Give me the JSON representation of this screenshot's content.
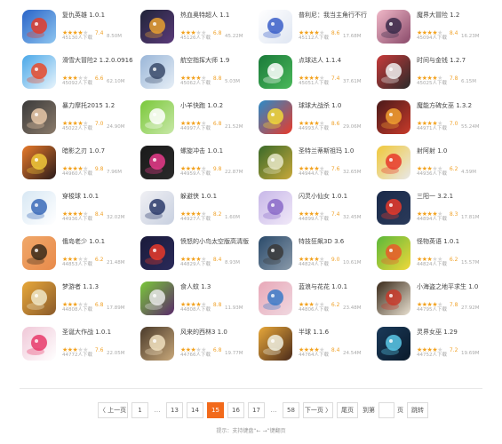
{
  "apps": [
    {
      "name": "复仇英雄 1.0.1",
      "stars": 4,
      "score": "7.4",
      "downloads": "45130人下载",
      "size": "8.50M",
      "icon": "captain-hero-icon",
      "c1": "#2a64c8",
      "c2": "#8ec6f0",
      "accent": "#e23c2a"
    },
    {
      "name": "热血奥特超人 1.1",
      "stars": 3,
      "score": "6.8",
      "downloads": "45126人下载",
      "size": "45.22M",
      "icon": "ultraman-icon",
      "c1": "#202438",
      "c2": "#5a3a7a",
      "accent": "#e8a030"
    },
    {
      "name": "普利尼：我当主角行不行",
      "stars": 4,
      "score": "8.6",
      "downloads": "45112人下载",
      "size": "17.68M",
      "icon": "prinny-icon",
      "c1": "#ffffff",
      "c2": "#dfe6f2",
      "accent": "#3a5ec8"
    },
    {
      "name": "魔界大冒险 1.2",
      "stars": 4,
      "score": "8.4",
      "downloads": "45094人下载",
      "size": "16.23M",
      "icon": "demon-girl-icon",
      "c1": "#f0b8c8",
      "c2": "#8a4a6a",
      "accent": "#3a2a4a"
    },
    {
      "name": "滑雪大冒险2 1.2.0.0916",
      "stars": 3,
      "score": "6.6",
      "downloads": "45092人下载",
      "size": "62.10M",
      "icon": "ski-safari-icon",
      "c1": "#4aa8e8",
      "c2": "#e8f4fc",
      "accent": "#e84a2a"
    },
    {
      "name": "航空指挥大师 1.9",
      "stars": 4,
      "score": "8.8",
      "downloads": "45062人下载",
      "size": "5.03M",
      "icon": "airplane-icon",
      "c1": "#9ab6d8",
      "c2": "#e6eef6",
      "accent": "#3a4a6a"
    },
    {
      "name": "点球达人 1.1.4",
      "stars": 4,
      "score": "7.4",
      "downloads": "45051人下载",
      "size": "37.61M",
      "icon": "soccer-ball-icon",
      "c1": "#1a7a3a",
      "c2": "#4ab85a",
      "accent": "#ffffff"
    },
    {
      "name": "时间与金钱 1.2.7",
      "stars": 4,
      "score": "7.8",
      "downloads": "45025人下载",
      "size": "6.15M",
      "icon": "time-money-icon",
      "c1": "#c83a3a",
      "c2": "#2a2a2a",
      "accent": "#f0f0f0"
    },
    {
      "name": "暴力摩托2015 1.2",
      "stars": 4,
      "score": "7.0",
      "downloads": "45022人下载",
      "size": "24.90M",
      "icon": "moto-rider-icon",
      "c1": "#3a3a3a",
      "c2": "#8a7a6a",
      "accent": "#e8c8a8"
    },
    {
      "name": "小羊快跑 1.0.2",
      "stars": 4,
      "score": "6.8",
      "downloads": "44997人下载",
      "size": "21.52M",
      "icon": "sheep-icon",
      "c1": "#7ac83a",
      "c2": "#c8e8a8",
      "accent": "#ffffff"
    },
    {
      "name": "球球大战杀 1.0",
      "stars": 4,
      "score": "8.6",
      "downloads": "44993人下载",
      "size": "29.06M",
      "icon": "ball-racer-icon",
      "c1": "#2a8ac8",
      "c2": "#e83a2a",
      "accent": "#f0d83a"
    },
    {
      "name": "魔能方碑女巫 1.3.2",
      "stars": 4,
      "score": "7.0",
      "downloads": "44971人下载",
      "size": "55.24M",
      "icon": "witch-icon",
      "c1": "#4a1a1a",
      "c2": "#c83a2a",
      "accent": "#f0a030"
    },
    {
      "name": "暗影之刃 1.0.7",
      "stars": 4,
      "score": "9.8",
      "downloads": "44960人下载",
      "size": "7.96M",
      "icon": "shadow-blade-icon",
      "c1": "#e87a2a",
      "c2": "#2a1a1a",
      "accent": "#f0c83a"
    },
    {
      "name": "螺旋冲击 1.0.1",
      "stars": 4,
      "score": "9.8",
      "downloads": "44959人下载",
      "size": "22.87M",
      "icon": "spiral-icon",
      "c1": "#1a1a1a",
      "c2": "#2a2a2a",
      "accent": "#e83a8a"
    },
    {
      "name": "圣特兰蒂斯祖玛 1.0",
      "stars": 4,
      "score": "7.6",
      "downloads": "44944人下载",
      "size": "32.65M",
      "icon": "zuma-icon",
      "c1": "#3a6a2a",
      "c2": "#c8a83a",
      "accent": "#e8e8c8"
    },
    {
      "name": "射阿射 1.0",
      "stars": 3,
      "score": "6.2",
      "downloads": "44936人下载",
      "size": "4.59M",
      "icon": "target-icon",
      "c1": "#f0c83a",
      "c2": "#e8e8e8",
      "accent": "#e83a2a"
    },
    {
      "name": "穿梭球 1.0.1",
      "stars": 4,
      "score": "8.4",
      "downloads": "44936人下载",
      "size": "32.02M",
      "icon": "shuttle-ball-icon",
      "c1": "#d8e8f4",
      "c2": "#ffffff",
      "accent": "#3a6ab8"
    },
    {
      "name": "躲避侠 1.0.1",
      "stars": 4,
      "score": "8.2",
      "downloads": "44927人下载",
      "size": "1.60M",
      "icon": "dodge-hero-icon",
      "c1": "#f0f0f4",
      "c2": "#c8d0e0",
      "accent": "#2a3a6a"
    },
    {
      "name": "闪灵小仙女 1.0.1",
      "stars": 4,
      "score": "7.4",
      "downloads": "44899人下载",
      "size": "32.45M",
      "icon": "fairy-icon",
      "c1": "#c8b8e8",
      "c2": "#f0e8f8",
      "accent": "#8a6ac8"
    },
    {
      "name": "三阳一 3.2.1",
      "stars": 4,
      "score": "8.3",
      "downloads": "44894人下载",
      "size": "17.81M",
      "icon": "three-sun-icon",
      "c1": "#1a2a4a",
      "c2": "#2a3a5a",
      "accent": "#e83a2a"
    },
    {
      "name": "俄岛老少 1.0.1",
      "stars": 3,
      "score": "6.2",
      "downloads": "44853人下载",
      "size": "21.48M",
      "icon": "bearded-man-icon",
      "c1": "#f0a86a",
      "c2": "#e88a4a",
      "accent": "#3a2a1a"
    },
    {
      "name": "愤怒的小鸟太空版高清版",
      "stars": 4,
      "score": "8.4",
      "downloads": "44829人下载",
      "size": "8.93M",
      "icon": "angry-birds-space-icon",
      "c1": "#1a1a3a",
      "c2": "#2a2a5a",
      "accent": "#e83a2a"
    },
    {
      "name": "特技狂飙3D 3.6",
      "stars": 4,
      "score": "9.0",
      "downloads": "44824人下载",
      "size": "10.61M",
      "icon": "stunt-racer-icon",
      "c1": "#2a4a6a",
      "c2": "#8a9aaa",
      "accent": "#3a3a3a"
    },
    {
      "name": "怪物英语 1.0.1",
      "stars": 3,
      "score": "6.2",
      "downloads": "44824人下载",
      "size": "15.57M",
      "icon": "monster-english-icon",
      "c1": "#5ab83a",
      "c2": "#f0d83a",
      "accent": "#e85a2a"
    },
    {
      "name": "梦游者 1.1.3",
      "stars": 3,
      "score": "6.8",
      "downloads": "44808人下载",
      "size": "17.89M",
      "icon": "sleepwalker-icon",
      "c1": "#e8a83a",
      "c2": "#8a5a2a",
      "accent": "#f0e8c8"
    },
    {
      "name": "食人蚊 1.3",
      "stars": 4,
      "score": "8.8",
      "downloads": "44808人下载",
      "size": "11.93M",
      "icon": "mosquito-icon",
      "c1": "#7ac83a",
      "c2": "#5a2a6a",
      "accent": "#e8e8e8"
    },
    {
      "name": "蓝浪与花花 1.0.1",
      "stars": 3,
      "score": "6.2",
      "downloads": "44806人下载",
      "size": "23.48M",
      "icon": "blue-wave-icon",
      "c1": "#e8a8b8",
      "c2": "#f0d8e0",
      "accent": "#3a7ac8"
    },
    {
      "name": "小海盗之地平求生 1.0",
      "stars": 4,
      "score": "7.8",
      "downloads": "44795人下载",
      "size": "27.92M",
      "icon": "pirate-icon",
      "c1": "#3a2a1a",
      "c2": "#e8e0d0",
      "accent": "#c83a2a"
    },
    {
      "name": "圣诞大作战 1.0.1",
      "stars": 3,
      "score": "7.6",
      "downloads": "44772人下载",
      "size": "22.05M",
      "icon": "christmas-girl-icon",
      "c1": "#f0c8d8",
      "c2": "#ffffff",
      "accent": "#e83a6a"
    },
    {
      "name": "风来的西林3 1.0",
      "stars": 3,
      "score": "6.8",
      "downloads": "44766人下载",
      "size": "19.77M",
      "icon": "shiren-icon",
      "c1": "#4a3a2a",
      "c2": "#c8a87a",
      "accent": "#f0e0c0"
    },
    {
      "name": "半球 1.1.6",
      "stars": 4,
      "score": "8.4",
      "downloads": "44764人下载",
      "size": "24.54M",
      "icon": "hemisphere-icon",
      "c1": "#e8a83a",
      "c2": "#4a2a1a",
      "accent": "#f0f0e0"
    },
    {
      "name": "灵界女巫 1.29",
      "stars": 4,
      "score": "7.2",
      "downloads": "44752人下载",
      "size": "19.69M",
      "icon": "spirit-witch-icon",
      "c1": "#1a3a5a",
      "c2": "#0a1a2a",
      "accent": "#5ac8e8"
    }
  ],
  "pagination": {
    "prev": "〈 上一页",
    "p1": "1",
    "ell1": "…",
    "p13": "13",
    "p14": "14",
    "p15": "15",
    "p16": "16",
    "p17": "17",
    "ell2": "…",
    "p58": "58",
    "next": "下一页 〉",
    "last": "尾页",
    "jump_to": "到第",
    "jump_value": "",
    "page_unit": "页",
    "go": "跳转",
    "current_page": 15
  },
  "hint": "提示：支持键盘“← →”键翻页"
}
